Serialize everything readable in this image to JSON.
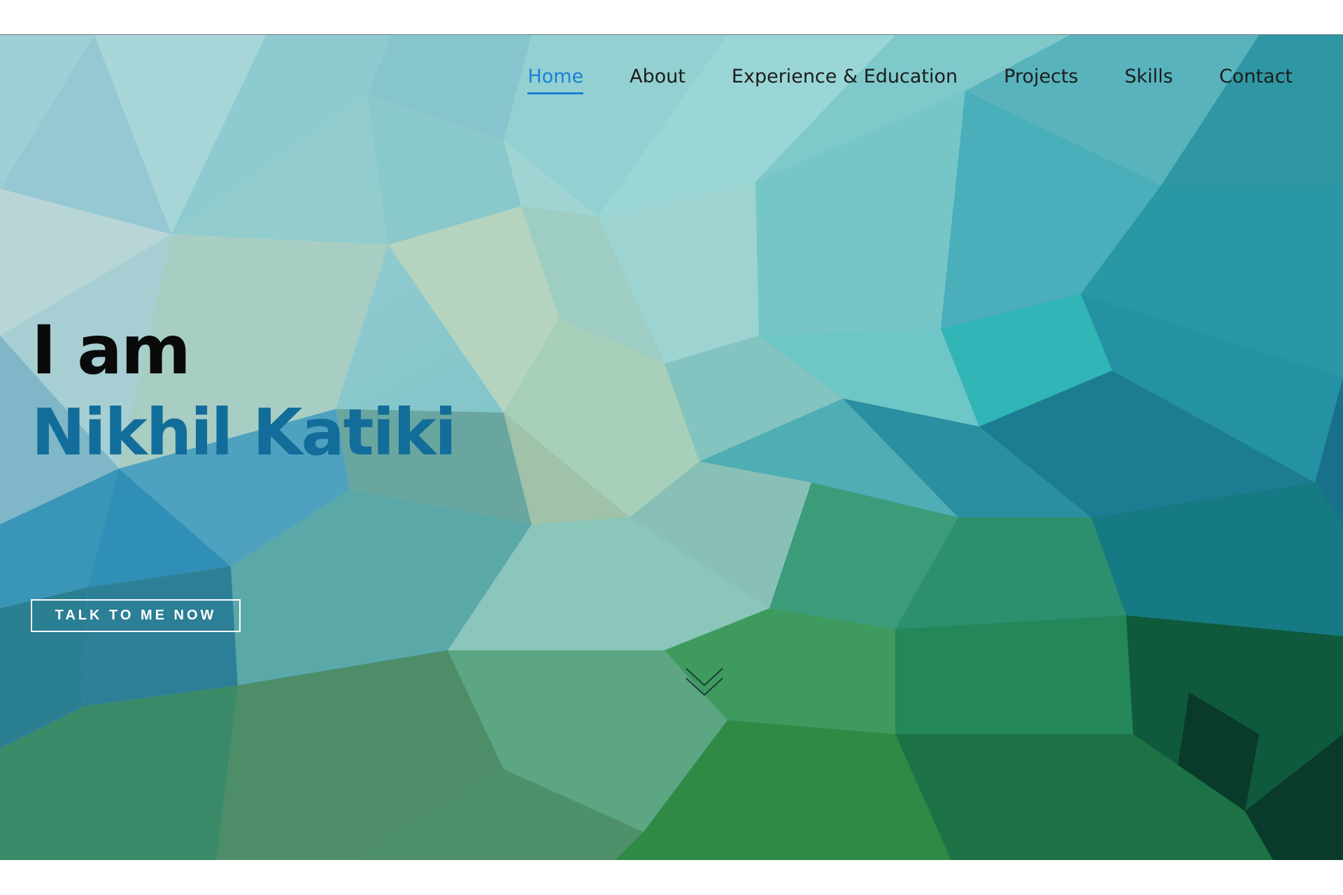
{
  "nav": {
    "items": [
      {
        "label": "Home",
        "active": true
      },
      {
        "label": "About",
        "active": false
      },
      {
        "label": "Experience & Education",
        "active": false
      },
      {
        "label": "Projects",
        "active": false
      },
      {
        "label": "Skills",
        "active": false
      },
      {
        "label": "Contact",
        "active": false
      }
    ]
  },
  "hero": {
    "greeting": "I am",
    "name": "Nikhil Katiki",
    "cta_label": "TALK TO ME NOW",
    "scroll_icon": "chevron-double-down-icon"
  },
  "colors": {
    "nav_active": "#1a7fd8",
    "name_color": "#136d9a",
    "greeting_color": "#0a0a0a"
  }
}
